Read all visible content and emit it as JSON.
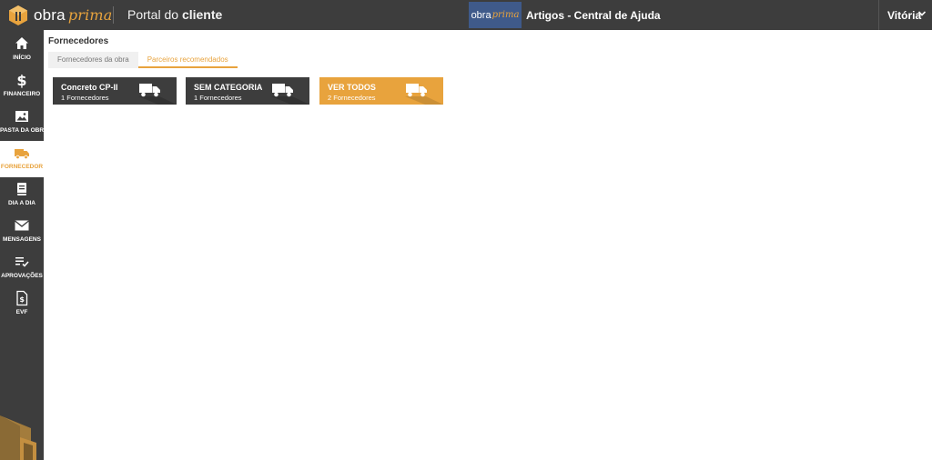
{
  "header": {
    "logo_text_1": "obra",
    "logo_text_2": "prima",
    "portal_prefix": "Portal do ",
    "portal_bold": "cliente",
    "help_logo_1": "obra",
    "help_logo_2": "prima",
    "help_title": "Artigos - Central de Ajuda",
    "user_name": "Vitória"
  },
  "sidebar": {
    "items": [
      {
        "label": "INÍCIO",
        "icon": "home-icon"
      },
      {
        "label": "FINANCEIRO",
        "icon": "dollar-icon"
      },
      {
        "label": "PASTA DA OBRA",
        "icon": "image-icon"
      },
      {
        "label": "FORNECEDOR",
        "icon": "truck-icon",
        "active": true
      },
      {
        "label": "DIA A DIA",
        "icon": "book-icon"
      },
      {
        "label": "MENSAGENS",
        "icon": "mail-icon"
      },
      {
        "label": "APROVAÇÕES",
        "icon": "checklist-icon"
      },
      {
        "label": "EVF",
        "icon": "document-dollar-icon"
      }
    ]
  },
  "main": {
    "title": "Fornecedores",
    "tabs": [
      {
        "label": "Fornecedores da obra",
        "active": false
      },
      {
        "label": "Parceiros recomendados",
        "active": true
      }
    ],
    "cards": [
      {
        "title": "Concreto CP-II",
        "subtitle": "1 Fornecedores"
      },
      {
        "title": "SEM CATEGORIA",
        "subtitle": "1 Fornecedores"
      },
      {
        "title": "VER TODOS",
        "subtitle": "2 Fornecedores"
      }
    ]
  },
  "colors": {
    "dark": "#3d3d3d",
    "accent": "#e8a33d",
    "help_logo_bg": "#3f5a8a"
  }
}
